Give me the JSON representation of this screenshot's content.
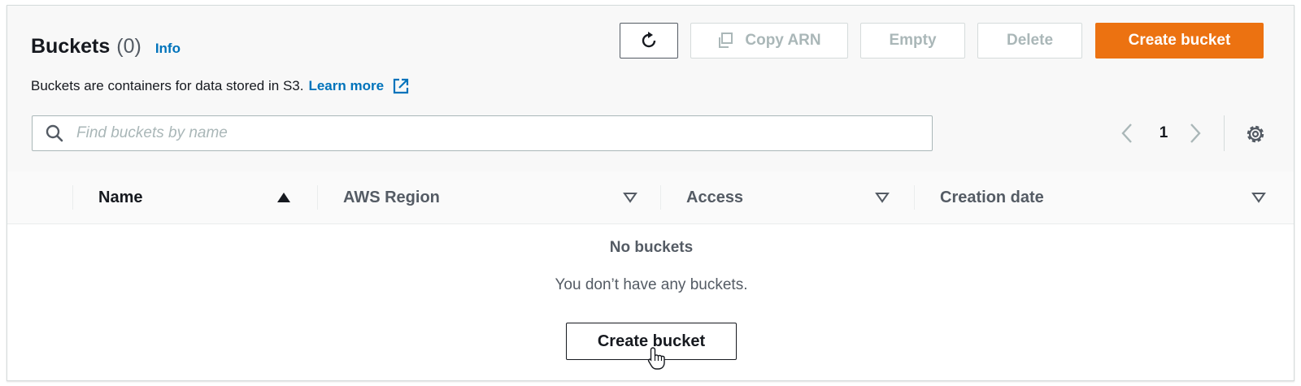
{
  "header": {
    "title": "Buckets",
    "count": "(0)",
    "info_label": "Info",
    "description": "Buckets are containers for data stored in S3.",
    "learn_more_label": "Learn more"
  },
  "toolbar": {
    "refresh_icon": "refresh-icon",
    "copy_arn_label": "Copy ARN",
    "empty_label": "Empty",
    "delete_label": "Delete",
    "create_label": "Create bucket"
  },
  "search": {
    "placeholder": "Find buckets by name",
    "value": ""
  },
  "pagination": {
    "current_page": "1"
  },
  "table": {
    "columns": [
      {
        "label": "Name",
        "sort": "ascending"
      },
      {
        "label": "AWS Region",
        "sort": "none"
      },
      {
        "label": "Access",
        "sort": "none"
      },
      {
        "label": "Creation date",
        "sort": "none"
      }
    ]
  },
  "empty_state": {
    "title": "No buckets",
    "description": "You don’t have any buckets.",
    "button_label": "Create bucket"
  },
  "colors": {
    "primary": "#ec7211",
    "link": "#0073bb",
    "text": "#16191f",
    "muted": "#545b64",
    "disabled": "#aab7b8"
  }
}
